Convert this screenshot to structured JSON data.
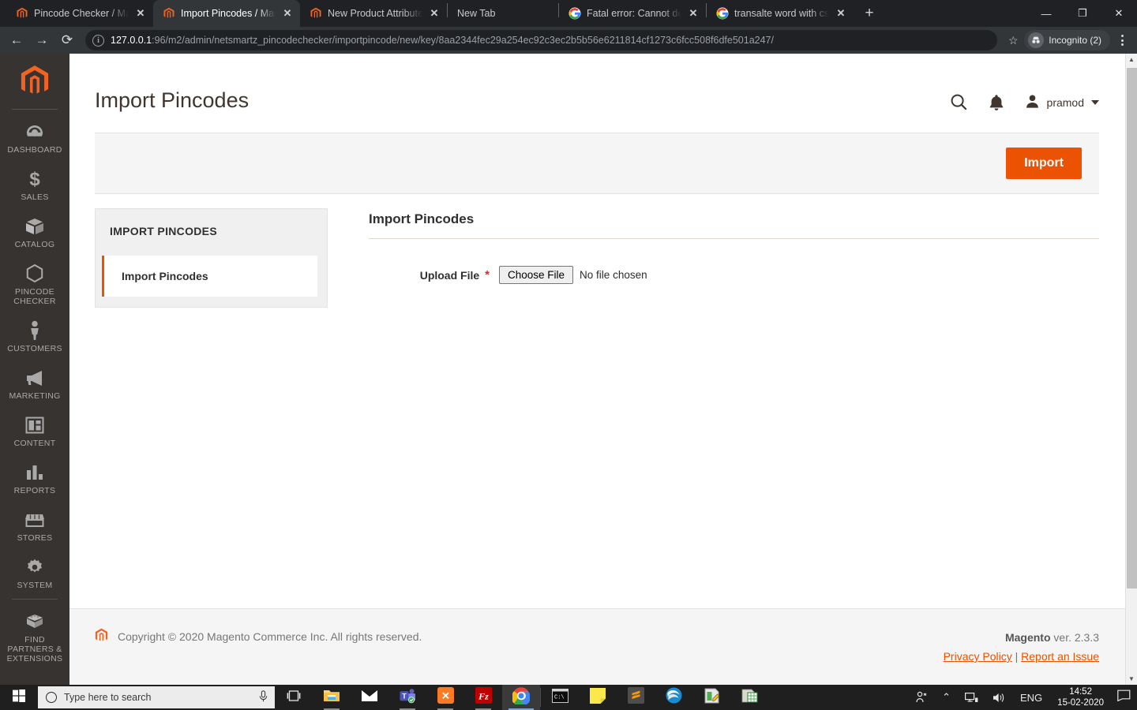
{
  "browser": {
    "tabs": [
      {
        "title": "Pincode Checker / Magen",
        "favicon": "magento-icon",
        "active": false,
        "close_label": "✕"
      },
      {
        "title": "Import Pincodes / Magen",
        "favicon": "magento-icon",
        "active": true,
        "close_label": "✕"
      },
      {
        "title": "New Product Attribute / P",
        "favicon": "magento-icon",
        "active": false,
        "close_label": "✕"
      },
      {
        "title": "New Tab",
        "favicon": "none",
        "active": false,
        "close_label": ""
      },
      {
        "title": "Fatal error: Cannot declare",
        "favicon": "google-icon",
        "active": false,
        "close_label": "✕"
      },
      {
        "title": "transalte word with css - G",
        "favicon": "google-icon",
        "active": false,
        "close_label": "✕"
      }
    ],
    "new_tab_button": "+",
    "window_controls": {
      "minimize": "—",
      "restore": "❐",
      "close": "✕"
    },
    "nav": {
      "back": "←",
      "forward": "→",
      "reload": "⟳"
    },
    "url_host": "127.0.0.1",
    "url_path": ":96/m2/admin/netsmartz_pincodechecker/importpincode/new/key/8aa2344fec29a254ec92c3ec2b5b56e6211814cf1273c6fcc508f6dfe501a247/",
    "bookmark_star": "☆",
    "profile_label": "Incognito (2)"
  },
  "sidebar": {
    "logo": "magento-logo",
    "items": [
      {
        "label": "Dashboard",
        "icon": "gauge-icon"
      },
      {
        "label": "Sales",
        "icon": "dollar-icon"
      },
      {
        "label": "Catalog",
        "icon": "box-icon"
      },
      {
        "label": "Pincode Checker",
        "icon": "hexagon-icon"
      },
      {
        "label": "Customers",
        "icon": "person-icon"
      },
      {
        "label": "Marketing",
        "icon": "megaphone-icon"
      },
      {
        "label": "Content",
        "icon": "layout-icon"
      },
      {
        "label": "Reports",
        "icon": "bar-chart-icon"
      },
      {
        "label": "Stores",
        "icon": "storefront-icon"
      },
      {
        "label": "System",
        "icon": "gear-icon"
      },
      {
        "label": "Find Partners & Extensions",
        "icon": "bricks-icon"
      }
    ]
  },
  "header": {
    "title": "Import Pincodes",
    "search_icon": "search-icon",
    "notifications_icon": "bell-icon",
    "user": "pramod"
  },
  "page_actions": {
    "import_label": "Import"
  },
  "side_panel": {
    "heading": "IMPORT PINCODES",
    "items": [
      {
        "label": "Import Pincodes",
        "active": true
      }
    ]
  },
  "form": {
    "legend": "Import Pincodes",
    "upload_label": "Upload File",
    "required_marker": "*",
    "choose_file_label": "Choose File",
    "file_status": "No file chosen"
  },
  "footer": {
    "copyright": "Copyright © 2020 Magento Commerce Inc. All rights reserved.",
    "version_brand": "Magento",
    "version_text": " ver. 2.3.3",
    "privacy_policy": "Privacy Policy",
    "separator": "|",
    "report_issue": "Report an Issue"
  },
  "taskbar": {
    "start_icon": "windows-icon",
    "search_placeholder": "Type here to search",
    "mic_icon": "microphone-icon",
    "taskview_icon": "task-view-icon",
    "apps": [
      {
        "name": "file-explorer-icon"
      },
      {
        "name": "mail-icon"
      },
      {
        "name": "microsoft-teams-icon"
      },
      {
        "name": "xampp-icon"
      },
      {
        "name": "filezilla-icon"
      },
      {
        "name": "google-chrome-icon"
      },
      {
        "name": "command-prompt-icon"
      },
      {
        "name": "sticky-notes-icon"
      },
      {
        "name": "sublime-text-icon"
      },
      {
        "name": "thunderbird-icon"
      },
      {
        "name": "notepad-plus-plus-icon"
      },
      {
        "name": "spreadsheet-icon"
      }
    ],
    "tray": {
      "people_icon": "people-icon",
      "chevron_up": "⌃",
      "network_icon": "network-icon",
      "volume_icon": "volume-icon",
      "language": "ENG",
      "time": "14:52",
      "date": "15-02-2020",
      "action_center_icon": "action-center-icon"
    }
  }
}
